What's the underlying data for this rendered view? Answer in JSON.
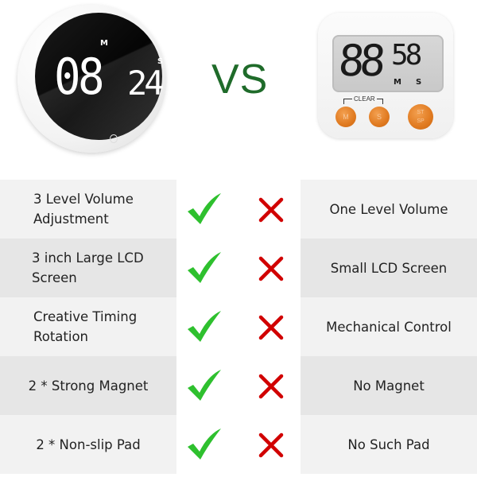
{
  "header": {
    "left_product": {
      "type": "round digital timer",
      "display_minutes": "08",
      "display_seconds": "24",
      "minutes_label": "M",
      "seconds_label": "S",
      "icon": "power-icon"
    },
    "versus_label": "VS",
    "right_product": {
      "type": "mechanical button timer",
      "display_minutes": "88",
      "display_seconds": "58",
      "minutes_label": "M",
      "seconds_label": "S",
      "clear_label": "CLEAR",
      "buttons": [
        {
          "label": "M"
        },
        {
          "label": "S"
        },
        {
          "label_top": "ST",
          "label_bottom": "SP"
        }
      ]
    }
  },
  "comparison": {
    "colors": {
      "check": "#2ec02e",
      "cross": "#d10000",
      "vs": "#1f6b2a",
      "row_light": "#f2f2f2",
      "row_dark": "#e6e6e6"
    },
    "rows": [
      {
        "left_line1": "3 Level Volume",
        "left_line2": "Adjustment",
        "left_has": "check",
        "right_has": "cross",
        "right": "One Level Volume"
      },
      {
        "left_line1": "3 inch Large LCD",
        "left_line2": "Screen",
        "left_has": "check",
        "right_has": "cross",
        "right": "Small LCD Screen"
      },
      {
        "left_line1": "Creative Timing",
        "left_line2": "Rotation",
        "left_has": "check",
        "right_has": "cross",
        "right": "Mechanical Control"
      },
      {
        "left_line1": "2 * Strong Magnet",
        "left_line2": "",
        "left_has": "check",
        "right_has": "cross",
        "right": "No Magnet"
      },
      {
        "left_line1": "2 * Non-slip Pad",
        "left_line2": "",
        "left_has": "check",
        "right_has": "cross",
        "right": "No Such Pad"
      }
    ]
  }
}
